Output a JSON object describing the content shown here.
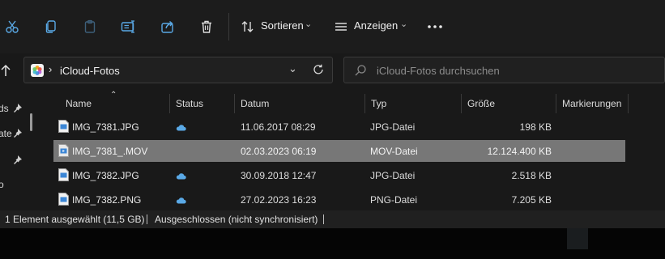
{
  "toolbar": {
    "cut_icon": "scissors-icon",
    "copy_icon": "copy-icon",
    "paste_icon": "paste-icon",
    "rename_icon": "rename-icon",
    "share_icon": "share-icon",
    "delete_icon": "trash-icon",
    "sort_label": "Sortieren",
    "view_label": "Anzeigen",
    "more_icon": "more-icon",
    "accent": "#5aa9e6"
  },
  "address": {
    "crumb": "iCloud-Fotos",
    "search_placeholder": "iCloud-Fotos durchsuchen"
  },
  "sidebar": {
    "items": [
      "ds",
      "ate",
      "",
      "o"
    ]
  },
  "columns": {
    "name": "Name",
    "status": "Status",
    "date": "Datum",
    "type": "Typ",
    "size": "Größe",
    "tags": "Markierungen"
  },
  "files": [
    {
      "name": "IMG_7381.JPG",
      "status": "cloud",
      "date": "11.06.2017 08:29",
      "type": "JPG-Datei",
      "size": "198 KB"
    },
    {
      "name": "IMG_7381_.MOV",
      "status": "",
      "date": "02.03.2023 06:19",
      "type": "MOV-Datei",
      "size": "12.124.400 KB"
    },
    {
      "name": "IMG_7382.JPG",
      "status": "cloud",
      "date": "30.09.2018 12:47",
      "type": "JPG-Datei",
      "size": "2.518 KB"
    },
    {
      "name": "IMG_7382.PNG",
      "status": "cloud",
      "date": "27.02.2023 16:23",
      "type": "PNG-Datei",
      "size": "7.205 KB"
    }
  ],
  "statusbar": {
    "selection": "1 Element ausgewählt (11,5 GB)",
    "sync": "Ausgeschlossen (nicht synchronisiert)"
  }
}
